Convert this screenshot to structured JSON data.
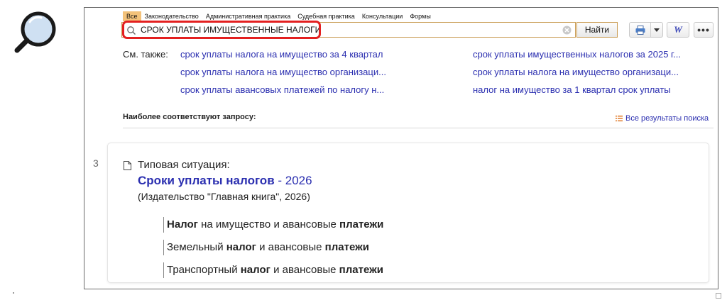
{
  "filter_tabs": [
    {
      "label": "Все",
      "active": true
    },
    {
      "label": "Законодательство",
      "active": false
    },
    {
      "label": "Административная практика",
      "active": false
    },
    {
      "label": "Судебная практика",
      "active": false
    },
    {
      "label": "Консультации",
      "active": false
    },
    {
      "label": "Формы",
      "active": false
    }
  ],
  "search": {
    "value": "СРОК УПЛАТЫ ИМУЩЕСТВЕННЫЕ НАЛОГИ",
    "find_label": "Найти"
  },
  "toolbar": {
    "print_icon": "printer-icon",
    "word_glyph": "W",
    "more_label": "•••"
  },
  "see_also": {
    "label": "См. также:",
    "links": [
      "срок уплаты налога на имущество за 4 квартал",
      "срок уплаты налога на имущество организаци...",
      "срок уплаты авансовых платежей по налогу н...",
      "срок уплаты имущественных налогов за 2025 г...",
      "срок уплаты налога на имущество организаци...",
      "налог на имущество за 1 квартал срок уплаты"
    ]
  },
  "relevant": {
    "title": "Наиболее соответствуют запросу:",
    "all_results_label": "Все результаты поиска"
  },
  "result": {
    "number": "3",
    "doc_type": "Типовая ситуация:",
    "title": "Сроки уплаты налогов",
    "title_sep": " - ",
    "year": "2026",
    "source": "(Издательство \"Главная книга\", 2026)",
    "sections": [
      [
        {
          "t": "Налог",
          "b": true
        },
        {
          "t": " на имущество и авансовые ",
          "b": false
        },
        {
          "t": "платежи",
          "b": true
        }
      ],
      [
        {
          "t": "Земельный ",
          "b": false
        },
        {
          "t": "налог",
          "b": true
        },
        {
          "t": " и авансовые ",
          "b": false
        },
        {
          "t": "платежи",
          "b": true
        }
      ],
      [
        {
          "t": "Транспортный ",
          "b": false
        },
        {
          "t": "налог",
          "b": true
        },
        {
          "t": " и авансовые ",
          "b": false
        },
        {
          "t": "платежи",
          "b": true
        }
      ]
    ]
  },
  "colors": {
    "accent": "#f3c27a",
    "link": "#2b2fb0",
    "highlight": "#e32020"
  }
}
